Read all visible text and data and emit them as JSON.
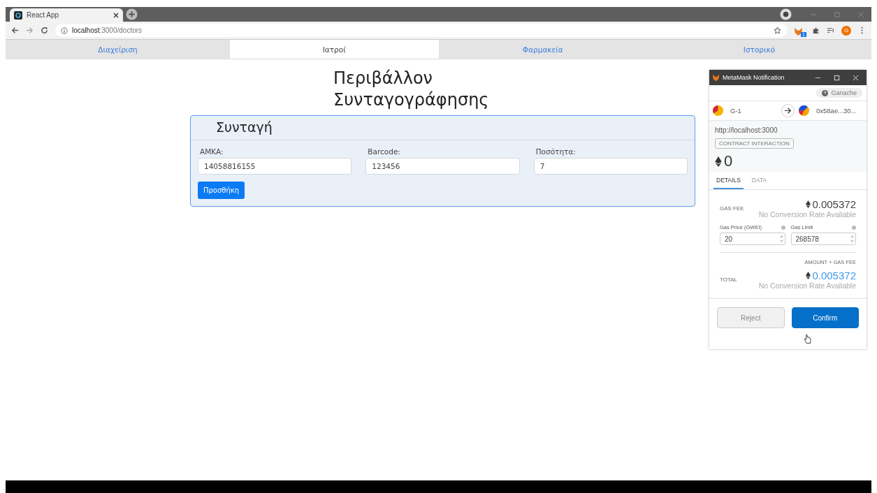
{
  "browser": {
    "tab_title": "React App",
    "url_host": "localhost",
    "url_path": ":3000/doctors",
    "extension_badge": "1",
    "profile_initial": "G"
  },
  "nav_tabs": [
    {
      "label": "Διαχείριση",
      "selected": false
    },
    {
      "label": "Ιατροί",
      "selected": true
    },
    {
      "label": "Φαρμακεία",
      "selected": false
    },
    {
      "label": "Ιστορικό",
      "selected": false
    }
  ],
  "page_title": [
    "Περιβάλλον",
    "Συνταγογράφησης"
  ],
  "card": {
    "title": "Συνταγή",
    "fields": [
      {
        "label": "AMKA:",
        "value": "14058816155"
      },
      {
        "label": "Barcode:",
        "value": "123456"
      },
      {
        "label": "Ποσότητα:",
        "value": "7"
      }
    ],
    "button": "Προσθήκη"
  },
  "metamask": {
    "window_title": "MetaMask Notification",
    "network": "Ganache",
    "from_account": "G-1",
    "to_account": "0x58ae...30...",
    "origin": "http://localhost:3000",
    "action_tag": "CONTRACT INTERACTION",
    "amount": "0",
    "tabs": [
      {
        "label": "DETAILS",
        "selected": true
      },
      {
        "label": "DATA",
        "selected": false
      }
    ],
    "gas_fee_label": "GAS FEE",
    "gas_fee": "0.005372",
    "gas_fee_note": "No Conversion Rate Available",
    "gas_price_label": "Gas Price (GWEI)",
    "gas_price": "20",
    "gas_limit_label": "Gas Limit",
    "gas_limit": "268578",
    "total_caption": "AMOUNT + GAS FEE",
    "total_label": "TOTAL",
    "total": "0.005372",
    "total_note": "No Conversion Rate Available",
    "reject": "Reject",
    "confirm": "Confirm"
  }
}
